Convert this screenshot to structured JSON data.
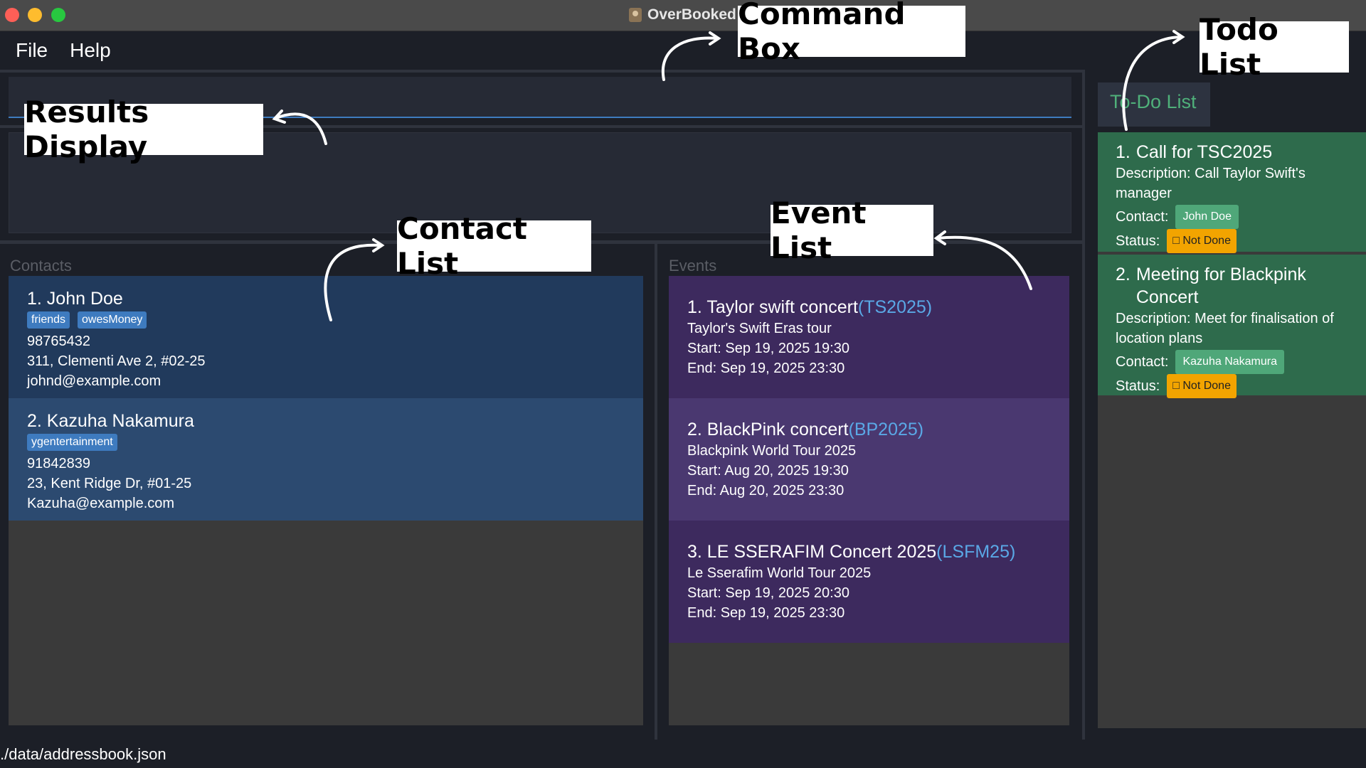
{
  "window": {
    "title": "OverBooked"
  },
  "menu": {
    "file": "File",
    "help": "Help"
  },
  "command_box": {
    "value": "",
    "placeholder": ""
  },
  "results_display": {
    "text": ""
  },
  "contacts": {
    "label": "Contacts",
    "items": [
      {
        "index_name": "1. John Doe",
        "tags": [
          "friends",
          "owesMoney"
        ],
        "phone": "98765432",
        "address": "311, Clementi Ave 2, #02-25",
        "email": "johnd@example.com",
        "bg": "#213a5c"
      },
      {
        "index_name": "2. Kazuha Nakamura",
        "tags": [
          "ygentertainment"
        ],
        "phone": "91842839",
        "address": "23, Kent Ridge Dr, #01-25",
        "email": "Kazuha@example.com",
        "bg": "#2c4a70"
      }
    ]
  },
  "events": {
    "label": "Events",
    "items": [
      {
        "title": "1. Taylor swift concert",
        "code": "(TS2025)",
        "description": "Taylor's Swift Eras tour",
        "start": "Start: Sep 19, 2025 19:30",
        "end": "End: Sep 19, 2025 23:30",
        "bg": "#3d2a5e"
      },
      {
        "title": "2. BlackPink concert",
        "code": "(BP2025)",
        "description": "Blackpink World Tour 2025",
        "start": "Start: Aug 20, 2025 19:30",
        "end": "End: Aug 20, 2025 23:30",
        "bg": "#4a3870"
      },
      {
        "title": "3. LE SSERAFIM Concert 2025",
        "code": "(LSFM25)",
        "description": "Le Sserafim World Tour 2025",
        "start": "Start: Sep 19, 2025 20:30",
        "end": "End: Sep 19, 2025 23:30",
        "bg": "#3d2a5e"
      }
    ]
  },
  "todo": {
    "tab_label": "To-Do List",
    "items": [
      {
        "num": "1.",
        "title": "Call for TSC2025",
        "description": "Description: Call Taylor Swift's manager",
        "contact_label": "Contact:",
        "contact": "John Doe",
        "status_label": "Status:",
        "status": "□ Not Done"
      },
      {
        "num": "2.",
        "title": "Meeting for Blackpink Concert",
        "description": "Description: Meet for finalisation of location plans",
        "contact_label": "Contact:",
        "contact": "Kazuha Nakamura",
        "status_label": "Status:",
        "status": "□ Not Done"
      }
    ]
  },
  "status_bar": {
    "path": "./data/addressbook.json"
  },
  "annotations": {
    "command_box": "Command Box",
    "todo_list": "Todo List",
    "results_display": "Results Display",
    "contact_list": "Contact List",
    "event_list": "Event List"
  }
}
